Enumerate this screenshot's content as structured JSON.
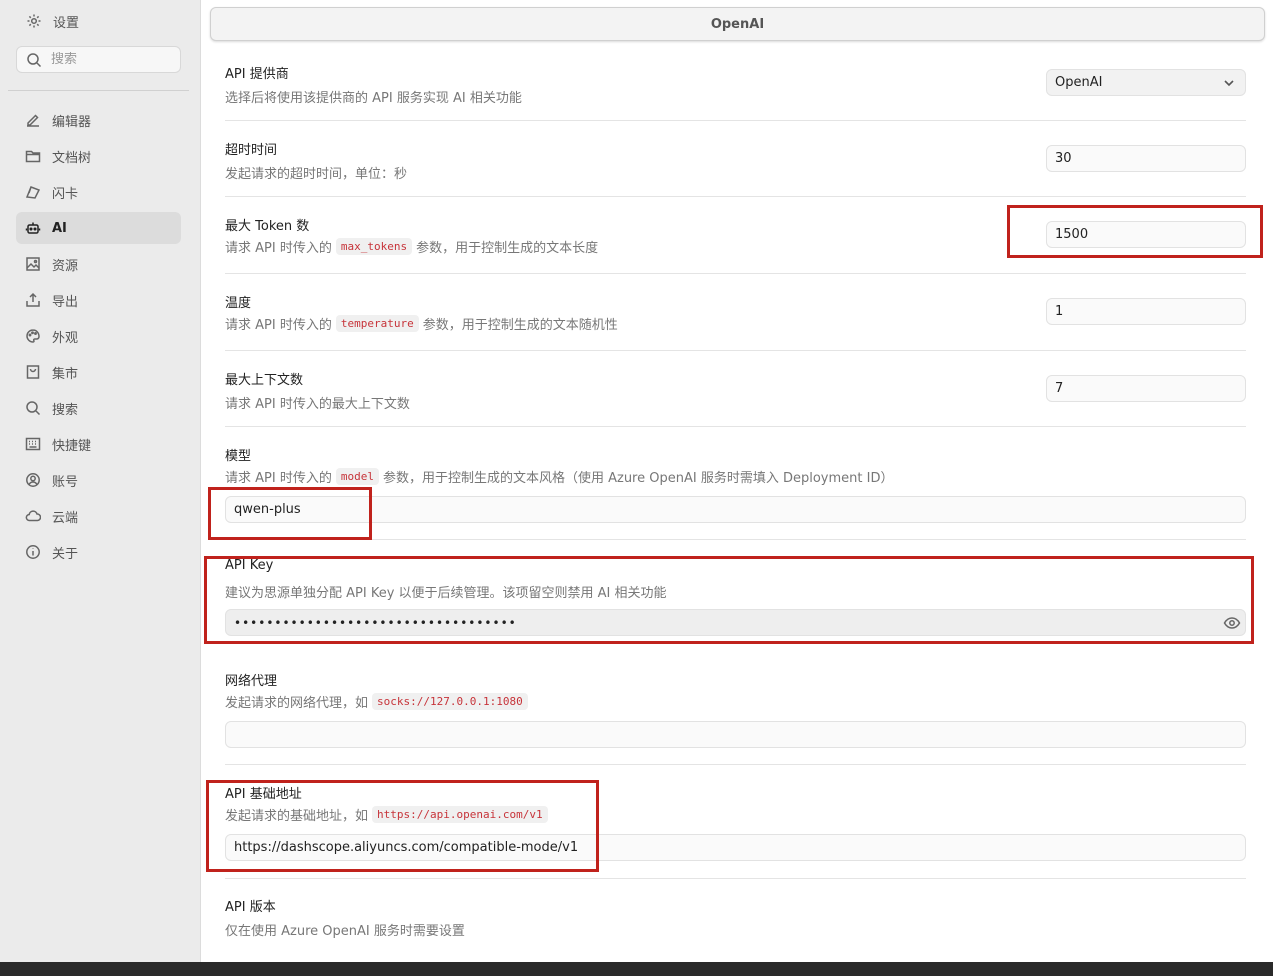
{
  "sidebar": {
    "title": "设置",
    "search_placeholder": "搜索",
    "items": [
      {
        "label": "编辑器",
        "icon": "pencil-icon"
      },
      {
        "label": "文档树",
        "icon": "folder-icon"
      },
      {
        "label": "闪卡",
        "icon": "flashcard-icon"
      },
      {
        "label": "AI",
        "icon": "robot-icon"
      },
      {
        "label": "资源",
        "icon": "image-icon"
      },
      {
        "label": "导出",
        "icon": "upload-icon"
      },
      {
        "label": "外观",
        "icon": "palette-icon"
      },
      {
        "label": "集市",
        "icon": "bag-icon"
      },
      {
        "label": "搜索",
        "icon": "search-icon"
      },
      {
        "label": "快捷键",
        "icon": "keyboard-icon"
      },
      {
        "label": "账号",
        "icon": "account-icon"
      },
      {
        "label": "云端",
        "icon": "cloud-icon"
      },
      {
        "label": "关于",
        "icon": "info-icon"
      }
    ],
    "active": "AI"
  },
  "main": {
    "tab": "OpenAI",
    "provider": {
      "label": "API 提供商",
      "desc": "选择后将使用该提供商的 API 服务实现 AI 相关功能",
      "value": "OpenAI"
    },
    "timeout": {
      "label": "超时时间",
      "desc": "发起请求的超时时间，单位：秒",
      "value": "30"
    },
    "max_tokens": {
      "label": "最大 Token 数",
      "desc_pre": "请求 API 时传入的",
      "code": "max_tokens",
      "desc_post": "参数，用于控制生成的文本长度",
      "value": "1500"
    },
    "temperature": {
      "label": "温度",
      "desc_pre": "请求 API 时传入的",
      "code": "temperature",
      "desc_post": "参数，用于控制生成的文本随机性",
      "value": "1"
    },
    "max_context": {
      "label": "最大上下文数",
      "desc": "请求 API 时传入的最大上下文数",
      "value": "7"
    },
    "model": {
      "label": "模型",
      "desc_pre": "请求 API 时传入的",
      "code": "model",
      "desc_post": "参数，用于控制生成的文本风格（使用 Azure OpenAI 服务时需填入 Deployment ID）",
      "value": "qwen-plus"
    },
    "api_key": {
      "label": "API Key",
      "desc": "建议为思源单独分配 API Key 以便于后续管理。该项留空则禁用 AI 相关功能",
      "value": "•••••••••••••••••••••••••••••••••••"
    },
    "proxy": {
      "label": "网络代理",
      "desc_pre": "发起请求的网络代理，如",
      "code": "socks://127.0.0.1:1080",
      "value": ""
    },
    "base_url": {
      "label": "API 基础地址",
      "desc_pre": "发起请求的基础地址，如",
      "code": "https://api.openai.com/v1",
      "value": "https://dashscope.aliyuncs.com/compatible-mode/v1"
    },
    "api_version": {
      "label": "API 版本",
      "desc": "仅在使用 Azure OpenAI 服务时需要设置"
    }
  },
  "colors": {
    "highlight": "#c0221c",
    "code_text": "#c7343a"
  }
}
